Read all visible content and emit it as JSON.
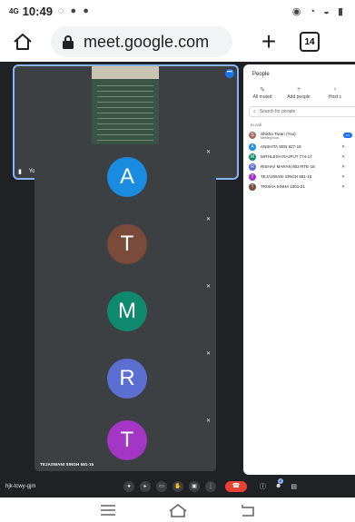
{
  "status_bar": {
    "signal": "4G",
    "time": "10:49",
    "left_icons": "◌ ● ●",
    "right_icons": "◉ ◔ ◒ ▮"
  },
  "browser": {
    "url": "meet.google.com",
    "tab_count": "14"
  },
  "meet": {
    "self_tile": {
      "name": "You"
    },
    "tiles": [
      {
        "initial": "A",
        "name": "ANSHITA SEN 927-19",
        "color": "#1a8ce0"
      },
      {
        "initial": "T",
        "name": "TRISHA SINHA 1001-21",
        "color": "#7a4a3a"
      },
      {
        "initial": "M",
        "name": "MITHLESH RAJPUT 774-17",
        "color": "#0f8a6e"
      },
      {
        "initial": "R",
        "name": "RISHAV MARAN 902-RTE-18",
        "color": "#5b6ed1"
      },
      {
        "initial": "T",
        "name": "TEJASWANI SINGH 581-15",
        "color": "#a436c6"
      }
    ],
    "meeting_code": "hjk-tcwy-gjm",
    "people_badge": "6"
  },
  "people_panel": {
    "title": "People",
    "actions": [
      {
        "label": "All muted"
      },
      {
        "label": "Add people"
      },
      {
        "label": "Host c"
      }
    ],
    "search_placeholder": "Search for people",
    "section_label": "In call",
    "participants": [
      {
        "initial": "S",
        "name": "Shikha Tiwari (You)",
        "sub": "Meeting host",
        "color": "#a56b6b"
      },
      {
        "initial": "A",
        "name": "ANSHITA SEN 927-19",
        "sub": "",
        "color": "#1a8ce0"
      },
      {
        "initial": "M",
        "name": "MITHLESH RAJPUT 774-17",
        "sub": "",
        "color": "#0f8a6e"
      },
      {
        "initial": "R",
        "name": "RISHAV MARAN 902-RTE-18",
        "sub": "",
        "color": "#5b6ed1"
      },
      {
        "initial": "T",
        "name": "TEJASWANI SINGH 581-15",
        "sub": "",
        "color": "#a436c6"
      },
      {
        "initial": "T",
        "name": "TRISHA SINHA 1001-21",
        "sub": "",
        "color": "#7a4a3a"
      }
    ]
  }
}
